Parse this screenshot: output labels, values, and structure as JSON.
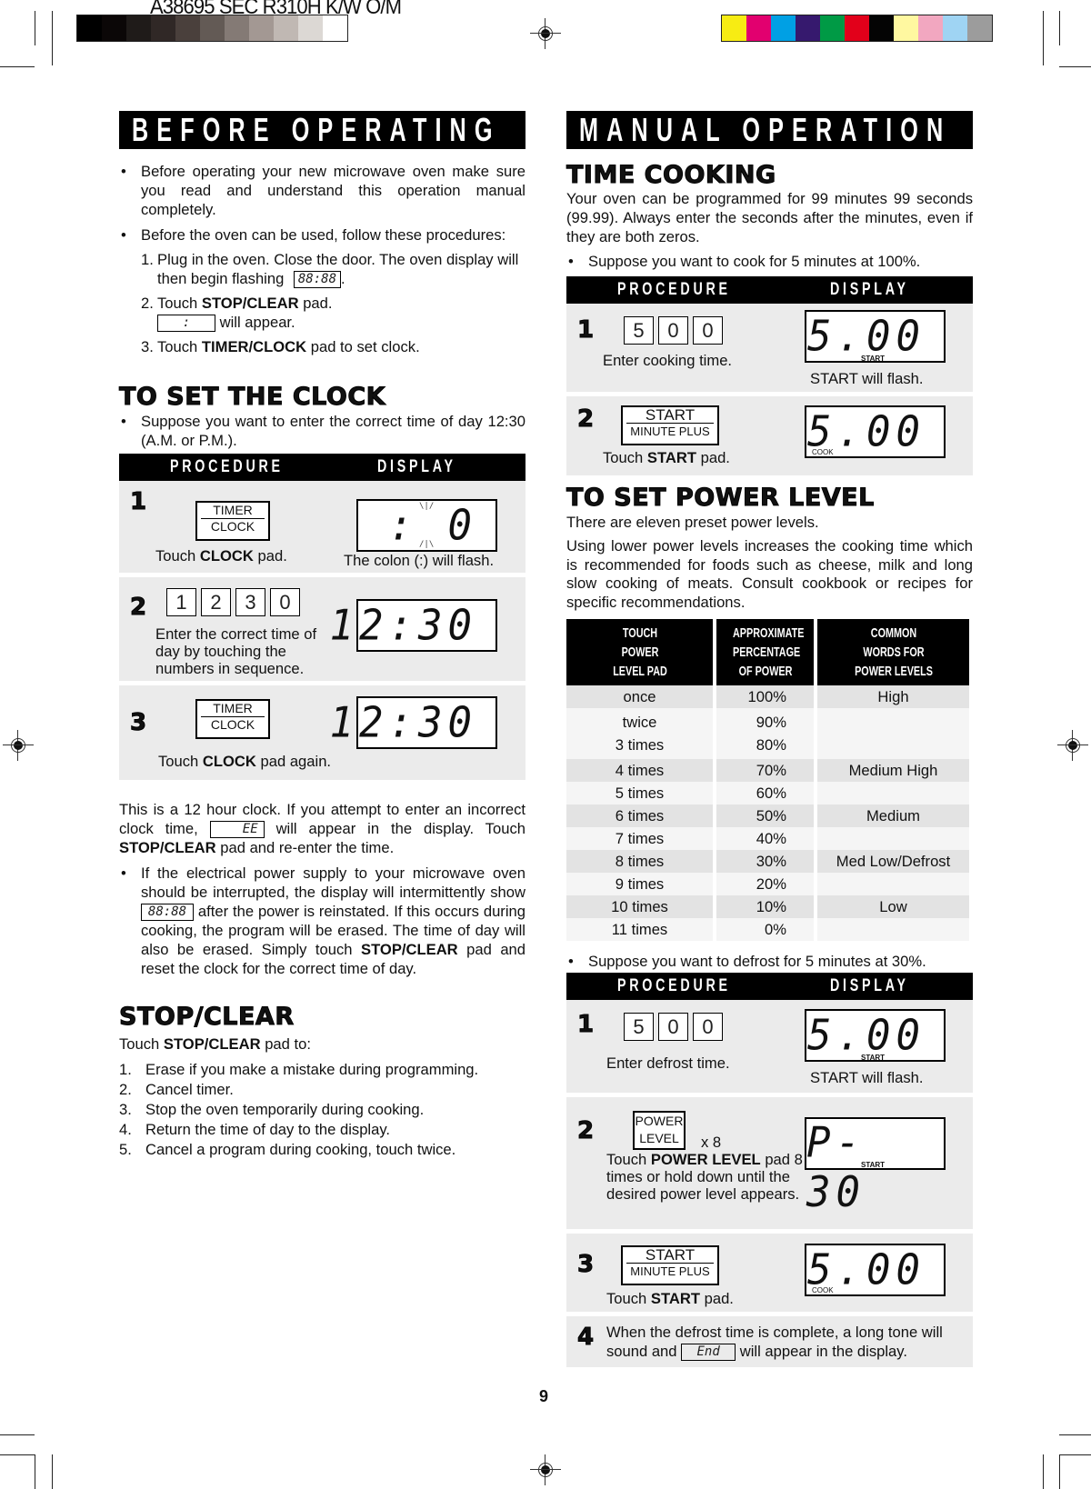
{
  "print_marks": {
    "job_id": "A38695 SEC R310H K/W O/M",
    "gray_swatches": [
      "#000000",
      "#0b0707",
      "#1f1b19",
      "#302826",
      "#4a403c",
      "#635a55",
      "#847a75",
      "#a39893",
      "#c0b8b3",
      "#dcd8d4",
      "#ffffff"
    ],
    "color_swatches": [
      "#f7ec13",
      "#e2006f",
      "#00a0e4",
      "#36196e",
      "#009a45",
      "#e2001a",
      "#040404",
      "#fff8a0",
      "#f2a7c0",
      "#9fd4f3",
      "#9c9c9c"
    ]
  },
  "left": {
    "banner": "BEFORE OPERATING",
    "intro_bullets": [
      "Before operating your new microwave oven make sure you read and understand this operation manual completely.",
      "Before the oven can be used, follow these procedures:"
    ],
    "procedures": {
      "p1_num": "1.",
      "p1_text_a": "Plug in the oven. Close the door. The oven display will then begin flashing",
      "p1_lcd": "88:88",
      "p1_text_b": ".",
      "p2_num": "2.",
      "p2_text_a": "Touch",
      "p2_bold": "STOP/CLEAR",
      "p2_text_b": "pad.",
      "p2_lcd": ":",
      "p2_text_c": "will appear.",
      "p3_num": "3.",
      "p3_text_a": "Touch",
      "p3_bold": "TIMER/CLOCK",
      "p3_text_b": "pad to set clock."
    },
    "clock": {
      "title": "TO SET THE CLOCK",
      "bullet": "Suppose you want to enter the correct time of day 12:30 (A.M. or P.M.).",
      "proc_header": "PROCEDURE",
      "display_header": "DISPLAY",
      "steps": [
        {
          "num": "1",
          "pad_top": "TIMER",
          "pad_bottom": "CLOCK",
          "caption_a": "Touch",
          "caption_bold": "CLOCK",
          "caption_b": "pad.",
          "lcd": ":  0",
          "display_caption": "The colon (:) will flash."
        },
        {
          "num": "2",
          "keys": [
            "1",
            "2",
            "3",
            "0"
          ],
          "caption": "Enter the correct time of day by touching the numbers in sequence.",
          "lcd": "12:30"
        },
        {
          "num": "3",
          "pad_top": "TIMER",
          "pad_bottom": "CLOCK",
          "caption_a": "Touch",
          "caption_bold": "CLOCK",
          "caption_b": "pad again.",
          "lcd": "12:30"
        }
      ]
    },
    "note": {
      "text_a": "This is a 12 hour clock. If you attempt to enter an incorrect clock time,",
      "lcd": "EE",
      "text_b": "will appear in the display. Touch",
      "bold": "STOP/CLEAR",
      "text_c": "pad and re-enter the time."
    },
    "power_bullet": {
      "text_a": "If the electrical power supply to your microwave oven should be interrupted, the display will intermittently show",
      "lcd": "88:88",
      "text_b": "after the power is reinstated. If this occurs during cooking, the program will be erased. The time of day will also be erased. Simply touch",
      "bold": "STOP/CLEAR",
      "text_c": "pad and reset the clock for the correct time of day."
    },
    "stop_clear": {
      "title": "STOP/CLEAR",
      "intro_a": "Touch",
      "intro_bold": "STOP/CLEAR",
      "intro_b": "pad to:",
      "items": [
        {
          "num": "1.",
          "text": "Erase if you make a mistake during programming."
        },
        {
          "num": "2.",
          "text": "Cancel timer."
        },
        {
          "num": "3.",
          "text": "Stop the oven temporarily during cooking."
        },
        {
          "num": "4.",
          "text": "Return the time of day to the display."
        },
        {
          "num": "5.",
          "text": "Cancel a program during cooking, touch twice."
        }
      ]
    }
  },
  "right": {
    "banner": "MANUAL OPERATION",
    "time_cooking": {
      "title": "TIME COOKING",
      "body": "Your oven can be programmed for 99 minutes 99 seconds (99.99). Always enter the seconds after the minutes, even if they are both zeros.",
      "bullet": "Suppose you want to cook for 5 minutes at 100%.",
      "proc_header": "PROCEDURE",
      "display_header": "DISPLAY",
      "steps": [
        {
          "num": "1",
          "keys": [
            "5",
            "0",
            "0"
          ],
          "caption": "Enter cooking time.",
          "lcd": "5.00",
          "lcd_tag": "START",
          "display_caption": "START will flash."
        },
        {
          "num": "2",
          "pad_top": "START",
          "pad_bottom": "MINUTE PLUS",
          "caption_a": "Touch",
          "caption_bold": "START",
          "caption_b": "pad.",
          "lcd": "5.00",
          "lcd_tag": "COOK"
        }
      ]
    },
    "power_level": {
      "title": "TO SET POWER LEVEL",
      "body1": "There are eleven preset power levels.",
      "body2": "Using lower power levels increases the cooking time which is recommended for foods such as cheese, milk and long slow cooking of meats. Consult cookbook or recipes for specific recommendations.",
      "table": {
        "headers": [
          "TOUCH POWER LEVEL PAD",
          "APPROXIMATE PERCENTAGE OF POWER",
          "COMMON WORDS FOR POWER LEVELS"
        ],
        "rows": [
          {
            "pad": "once",
            "pct": "100%",
            "word": "High"
          },
          {
            "pad": "twice",
            "pct": "90%",
            "word": ""
          },
          {
            "pad": "3 times",
            "pct": "80%",
            "word": ""
          },
          {
            "pad": "4 times",
            "pct": "70%",
            "word": "Medium High"
          },
          {
            "pad": "5 times",
            "pct": "60%",
            "word": ""
          },
          {
            "pad": "6 times",
            "pct": "50%",
            "word": "Medium"
          },
          {
            "pad": "7 times",
            "pct": "40%",
            "word": ""
          },
          {
            "pad": "8 times",
            "pct": "30%",
            "word": "Med Low/Defrost"
          },
          {
            "pad": "9 times",
            "pct": "20%",
            "word": ""
          },
          {
            "pad": "10 times",
            "pct": "10%",
            "word": "Low"
          },
          {
            "pad": "11 times",
            "pct": "0%",
            "word": ""
          }
        ]
      },
      "bullet": "Suppose you want to defrost for 5 minutes at 30%.",
      "proc_header": "PROCEDURE",
      "display_header": "DISPLAY",
      "steps": [
        {
          "num": "1",
          "keys": [
            "5",
            "0",
            "0"
          ],
          "caption": "Enter defrost time.",
          "lcd": "5.00",
          "lcd_tag": "START",
          "display_caption": "START will flash."
        },
        {
          "num": "2",
          "pad_top": "POWER",
          "pad_bottom": "LEVEL",
          "multiplier": "x 8",
          "caption_a": "Touch",
          "caption_bold": "POWER LEVEL",
          "caption_b": "pad 8 times or hold down until the desired power level appears.",
          "lcd": "P- 30",
          "lcd_tag": "START"
        },
        {
          "num": "3",
          "pad_top": "START",
          "pad_bottom": "MINUTE PLUS",
          "caption_a": "Touch",
          "caption_bold": "START",
          "caption_b": "pad.",
          "lcd": "5.00",
          "lcd_tag": "COOK"
        },
        {
          "num": "4",
          "text_a": "When the defrost time is complete, a long tone will sound and",
          "lcd": "End",
          "text_b": "will appear in the display."
        }
      ]
    }
  },
  "page_number": "9"
}
